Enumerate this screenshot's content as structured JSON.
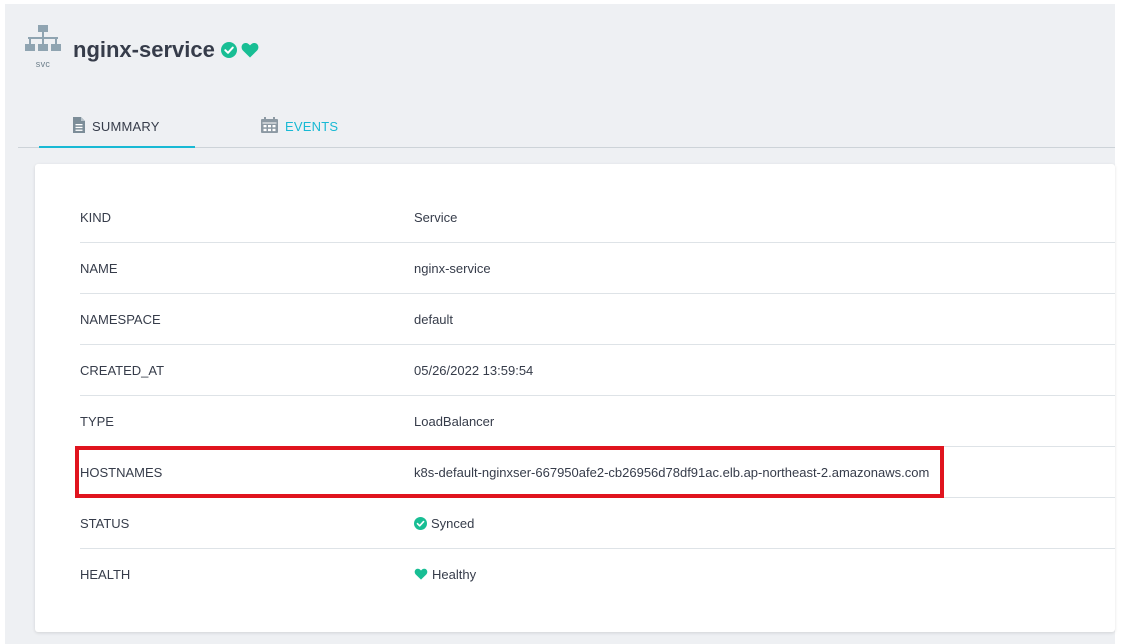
{
  "header": {
    "resource_kind_label": "svc",
    "title": "nginx-service",
    "sync_icon": "check-circle-icon",
    "health_icon": "heart-icon",
    "accent_color": "#18b9d4",
    "status_color": "#18be94"
  },
  "tabs": [
    {
      "label": "SUMMARY",
      "icon": "file-icon",
      "active": true
    },
    {
      "label": "EVENTS",
      "icon": "calendar-icon",
      "active": false
    }
  ],
  "summary": {
    "rows": [
      {
        "key": "KIND",
        "value": "Service"
      },
      {
        "key": "NAME",
        "value": "nginx-service"
      },
      {
        "key": "NAMESPACE",
        "value": "default"
      },
      {
        "key": "CREATED_AT",
        "value": "05/26/2022 13:59:54"
      },
      {
        "key": "TYPE",
        "value": "LoadBalancer"
      },
      {
        "key": "HOSTNAMES",
        "value": "k8s-default-nginxser-667950afe2-cb26956d78df91ac.elb.ap-northeast-2.amazonaws.com"
      },
      {
        "key": "STATUS",
        "value": "Synced",
        "icon": "check-circle-icon"
      },
      {
        "key": "HEALTH",
        "value": "Healthy",
        "icon": "heart-icon"
      }
    ],
    "highlight_color": "#e0141e"
  }
}
